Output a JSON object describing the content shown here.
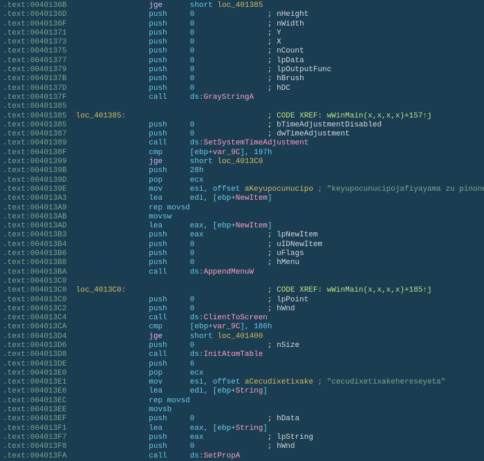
{
  "lines": [
    {
      "addr": ".text:0040136B",
      "label": "",
      "mnem": "jge",
      "mclass": "kw-jump",
      "op": "short ",
      "loc": "loc_401385",
      "comment": ""
    },
    {
      "addr": ".text:0040136D",
      "label": "",
      "mnem": "push",
      "mclass": "kw-regular",
      "op": "0",
      "comment": "; nHeight"
    },
    {
      "addr": ".text:0040136F",
      "label": "",
      "mnem": "push",
      "mclass": "kw-regular",
      "op": "0",
      "comment": "; nWidth"
    },
    {
      "addr": ".text:00401371",
      "label": "",
      "mnem": "push",
      "mclass": "kw-regular",
      "op": "0",
      "comment": "; Y"
    },
    {
      "addr": ".text:00401373",
      "label": "",
      "mnem": "push",
      "mclass": "kw-regular",
      "op": "0",
      "comment": "; X"
    },
    {
      "addr": ".text:00401375",
      "label": "",
      "mnem": "push",
      "mclass": "kw-regular",
      "op": "0",
      "comment": "; nCount"
    },
    {
      "addr": ".text:00401377",
      "label": "",
      "mnem": "push",
      "mclass": "kw-regular",
      "op": "0",
      "comment": "; lpData"
    },
    {
      "addr": ".text:00401379",
      "label": "",
      "mnem": "push",
      "mclass": "kw-regular",
      "op": "0",
      "comment": "; lpOutputFunc"
    },
    {
      "addr": ".text:0040137B",
      "label": "",
      "mnem": "push",
      "mclass": "kw-regular",
      "op": "0",
      "comment": "; hBrush"
    },
    {
      "addr": ".text:0040137D",
      "label": "",
      "mnem": "push",
      "mclass": "kw-regular",
      "op": "0",
      "comment": "; hDC"
    },
    {
      "addr": ".text:0040137F",
      "label": "",
      "mnem": "call",
      "mclass": "kw-regular",
      "opdscall": "GrayStringA",
      "comment": ""
    },
    {
      "addr": ".text:00401385",
      "label": "",
      "blank": true
    },
    {
      "addr": ".text:00401385",
      "label": "loc_401385:",
      "mnem": "",
      "op": "",
      "xref": "; CODE XREF: wWinMain(x,x,x,x)+157↑j"
    },
    {
      "addr": ".text:00401385",
      "label": "",
      "mnem": "push",
      "mclass": "kw-regular",
      "op": "0",
      "comment": "; bTimeAdjustmentDisabled"
    },
    {
      "addr": ".text:00401387",
      "label": "",
      "mnem": "push",
      "mclass": "kw-regular",
      "op": "0",
      "comment": "; dwTimeAdjustment"
    },
    {
      "addr": ".text:00401389",
      "label": "",
      "mnem": "call",
      "mclass": "kw-regular",
      "opdscall": "SetSystemTimeAdjustment",
      "comment": ""
    },
    {
      "addr": ".text:0040138F",
      "label": "",
      "mnem": "cmp",
      "mclass": "kw-regular",
      "opebpvar": "var_9C",
      "tail": ", 197h",
      "comment": ""
    },
    {
      "addr": ".text:00401399",
      "label": "",
      "mnem": "jge",
      "mclass": "kw-jump",
      "op": "short ",
      "loc": "loc_4013C0",
      "comment": ""
    },
    {
      "addr": ".text:0040139B",
      "label": "",
      "mnem": "push",
      "mclass": "kw-regular",
      "op": "28h",
      "comment": ""
    },
    {
      "addr": ".text:0040139D",
      "label": "",
      "mnem": "pop",
      "mclass": "kw-regular",
      "op": "ecx",
      "comment": ""
    },
    {
      "addr": ".text:0040139E",
      "label": "",
      "mnem": "mov",
      "mclass": "kw-regular",
      "opreg": "esi",
      "opoff": "offset ",
      "offlabel": "aKeyupocunucipo",
      "strcomment": "; \"keyupocunucipojafiyayama zu pinonebazah\"..."
    },
    {
      "addr": ".text:004013A3",
      "label": "",
      "mnem": "lea",
      "mclass": "kw-regular",
      "opreg": "edi",
      "opebpvar2": "NewItem",
      "comment": ""
    },
    {
      "addr": ".text:004013A9",
      "label": "",
      "mnem": "rep movsd",
      "mclass": "kw-regular",
      "op": "",
      "comment": ""
    },
    {
      "addr": ".text:004013AB",
      "label": "",
      "mnem": "movsw",
      "mclass": "kw-regular",
      "op": "",
      "comment": ""
    },
    {
      "addr": ".text:004013AD",
      "label": "",
      "mnem": "lea",
      "mclass": "kw-regular",
      "opreg": "eax",
      "opebpvar2": "NewItem",
      "comment": ""
    },
    {
      "addr": ".text:004013B3",
      "label": "",
      "mnem": "push",
      "mclass": "kw-regular",
      "op": "eax",
      "comment": "; lpNewItem"
    },
    {
      "addr": ".text:004013B4",
      "label": "",
      "mnem": "push",
      "mclass": "kw-regular",
      "op": "0",
      "comment": "; uIDNewItem"
    },
    {
      "addr": ".text:004013B6",
      "label": "",
      "mnem": "push",
      "mclass": "kw-regular",
      "op": "0",
      "comment": "; uFlags"
    },
    {
      "addr": ".text:004013B8",
      "label": "",
      "mnem": "push",
      "mclass": "kw-regular",
      "op": "0",
      "comment": "; hMenu"
    },
    {
      "addr": ".text:004013BA",
      "label": "",
      "mnem": "call",
      "mclass": "kw-regular",
      "opdscall": "AppendMenuW",
      "comment": ""
    },
    {
      "addr": ".text:004013C0",
      "label": "",
      "blank": true
    },
    {
      "addr": ".text:004013C0",
      "label": "loc_4013C0:",
      "mnem": "",
      "op": "",
      "xref": "; CODE XREF: wWinMain(x,x,x,x)+185↑j"
    },
    {
      "addr": ".text:004013C0",
      "label": "",
      "mnem": "push",
      "mclass": "kw-regular",
      "op": "0",
      "comment": "; lpPoint"
    },
    {
      "addr": ".text:004013C2",
      "label": "",
      "mnem": "push",
      "mclass": "kw-regular",
      "op": "0",
      "comment": "; hWnd"
    },
    {
      "addr": ".text:004013C4",
      "label": "",
      "mnem": "call",
      "mclass": "kw-regular",
      "opdscall": "ClientToScreen",
      "comment": ""
    },
    {
      "addr": ".text:004013CA",
      "label": "",
      "mnem": "cmp",
      "mclass": "kw-regular",
      "opebpvar": "var_9C",
      "tail": ", 186h",
      "comment": ""
    },
    {
      "addr": ".text:004013D4",
      "label": "",
      "mnem": "jge",
      "mclass": "kw-jump",
      "op": "short ",
      "loc": "loc_401400",
      "comment": ""
    },
    {
      "addr": ".text:004013D6",
      "label": "",
      "mnem": "push",
      "mclass": "kw-regular",
      "op": "0",
      "comment": "; nSize"
    },
    {
      "addr": ".text:004013D8",
      "label": "",
      "mnem": "call",
      "mclass": "kw-regular",
      "opdscall": "InitAtomTable",
      "comment": ""
    },
    {
      "addr": ".text:004013DE",
      "label": "",
      "mnem": "push",
      "mclass": "kw-regular",
      "op": "6",
      "comment": ""
    },
    {
      "addr": ".text:004013E0",
      "label": "",
      "mnem": "pop",
      "mclass": "kw-regular",
      "op": "ecx",
      "comment": ""
    },
    {
      "addr": ".text:004013E1",
      "label": "",
      "mnem": "mov",
      "mclass": "kw-regular",
      "opreg": "esi",
      "opoff": "offset ",
      "offlabel": "aCecudixetixake",
      "strcomment": "; \"cecudixetixakehereseyeta\""
    },
    {
      "addr": ".text:004013E6",
      "label": "",
      "mnem": "lea",
      "mclass": "kw-regular",
      "opreg": "edi",
      "opebpvar2": "String",
      "comment": ""
    },
    {
      "addr": ".text:004013EC",
      "label": "",
      "mnem": "rep movsd",
      "mclass": "kw-regular",
      "op": "",
      "comment": ""
    },
    {
      "addr": ".text:004013EE",
      "label": "",
      "mnem": "movsb",
      "mclass": "kw-regular",
      "op": "",
      "comment": ""
    },
    {
      "addr": ".text:004013EF",
      "label": "",
      "mnem": "push",
      "mclass": "kw-regular",
      "op": "0",
      "comment": "; hData"
    },
    {
      "addr": ".text:004013F1",
      "label": "",
      "mnem": "lea",
      "mclass": "kw-regular",
      "opreg": "eax",
      "opebpvar2": "String",
      "comment": ""
    },
    {
      "addr": ".text:004013F7",
      "label": "",
      "mnem": "push",
      "mclass": "kw-regular",
      "op": "eax",
      "comment": "; lpString"
    },
    {
      "addr": ".text:004013F8",
      "label": "",
      "mnem": "push",
      "mclass": "kw-regular",
      "op": "0",
      "comment": "; hWnd"
    },
    {
      "addr": ".text:004013FA",
      "label": "",
      "mnem": "call",
      "mclass": "kw-regular",
      "opdscall": "SetPropA",
      "comment": ""
    }
  ],
  "col": {
    "addr": 0,
    "label": 16,
    "mnem": 32,
    "op": 41,
    "comment": 58
  }
}
